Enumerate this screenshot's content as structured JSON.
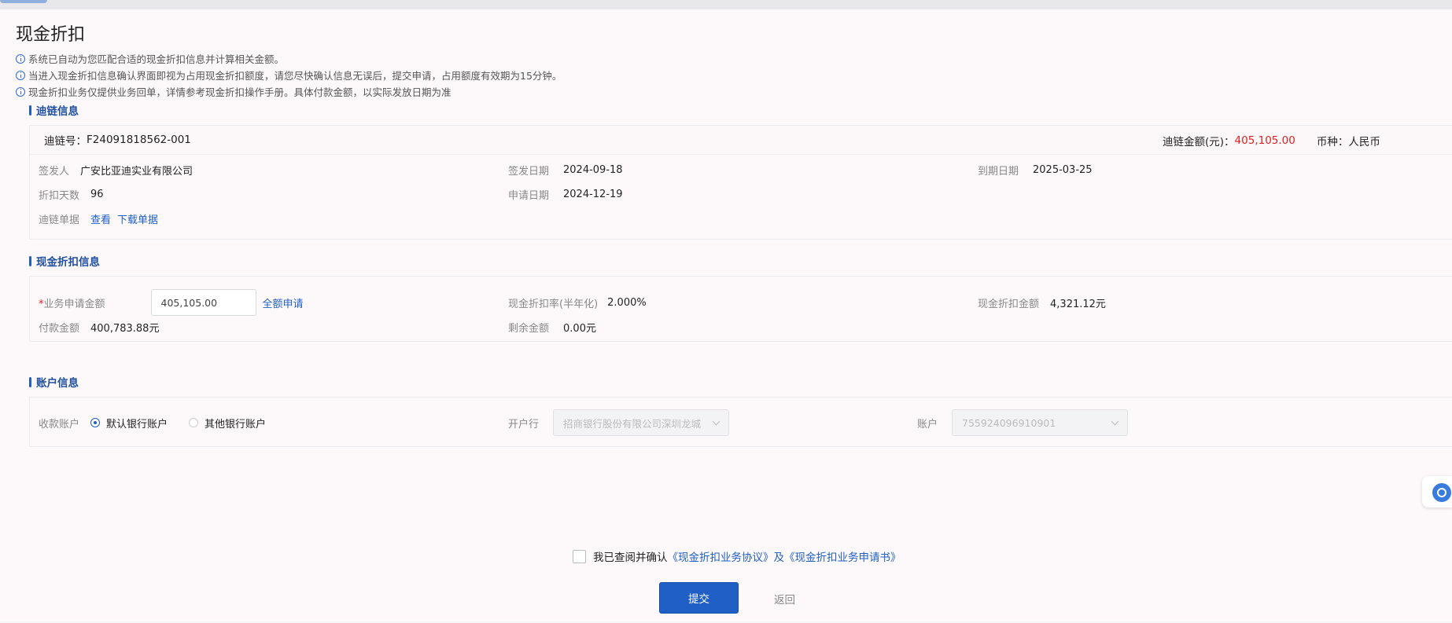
{
  "page": {
    "title": "现金折扣",
    "tips": [
      "系统已自动为您匹配合适的现金折扣信息并计算相关金额。",
      "当进入现金折扣信息确认界面即视为占用现金折扣额度，请您尽快确认信息无误后，提交申请，占用额度有效期为15分钟。",
      "现金折扣业务仅提供业务回单，详情参考现金折扣操作手册。具体付款金额，以实际发放日期为准"
    ]
  },
  "chain_info": {
    "section_title": "迪链信息",
    "chain_no_label": "迪链号：",
    "chain_no": "F24091818562-001",
    "amount_label": "迪链金额(元)：",
    "amount": "405,105.00",
    "currency_label": "币种：",
    "currency": "人民币",
    "issuer_label": "签发人",
    "issuer": "广安比亚迪实业有限公司",
    "issue_date_label": "签发日期",
    "issue_date": "2024-09-18",
    "due_date_label": "到期日期",
    "due_date": "2025-03-25",
    "discount_days_label": "折扣天数",
    "discount_days": "96",
    "apply_date_label": "申请日期",
    "apply_date": "2024-12-19",
    "doc_label": "迪链单据",
    "view_link": "查看",
    "download_link": "下载单据"
  },
  "discount_info": {
    "section_title": "现金折扣信息",
    "required_mark": "*",
    "apply_amount_label": "业务申请金额",
    "apply_amount_value": "405,105.00",
    "full_apply_link": "全额申请",
    "rate_label": "现金折扣率(半年化)",
    "rate": "2.000%",
    "discount_amount_label": "现金折扣金额",
    "discount_amount": "4,321.12元",
    "pay_amount_label": "付款金额",
    "pay_amount": "400,783.88元",
    "remain_label": "剩余金额",
    "remain": "0.00元"
  },
  "account_info": {
    "section_title": "账户信息",
    "receive_label": "收款账户",
    "default_account": "默认银行账户",
    "other_account": "其他银行账户",
    "bank_label": "开户行",
    "bank_value": "招商银行股份有限公司深圳龙城",
    "account_label": "账户",
    "account_value": "755924096910901"
  },
  "footer": {
    "agree_text": "我已查阅并确认",
    "agreement_link": "《现金折扣业务协议》及《现金折扣业务申请书》",
    "submit": "提交",
    "back": "返回"
  },
  "icons": {
    "tip_icon": "info-circle-icon",
    "dropdown_icon": "chevron-down-icon",
    "help_icon": "customer-service-icon"
  },
  "colors": {
    "accent": "#1f5fc6",
    "amount_red": "#e02020"
  }
}
